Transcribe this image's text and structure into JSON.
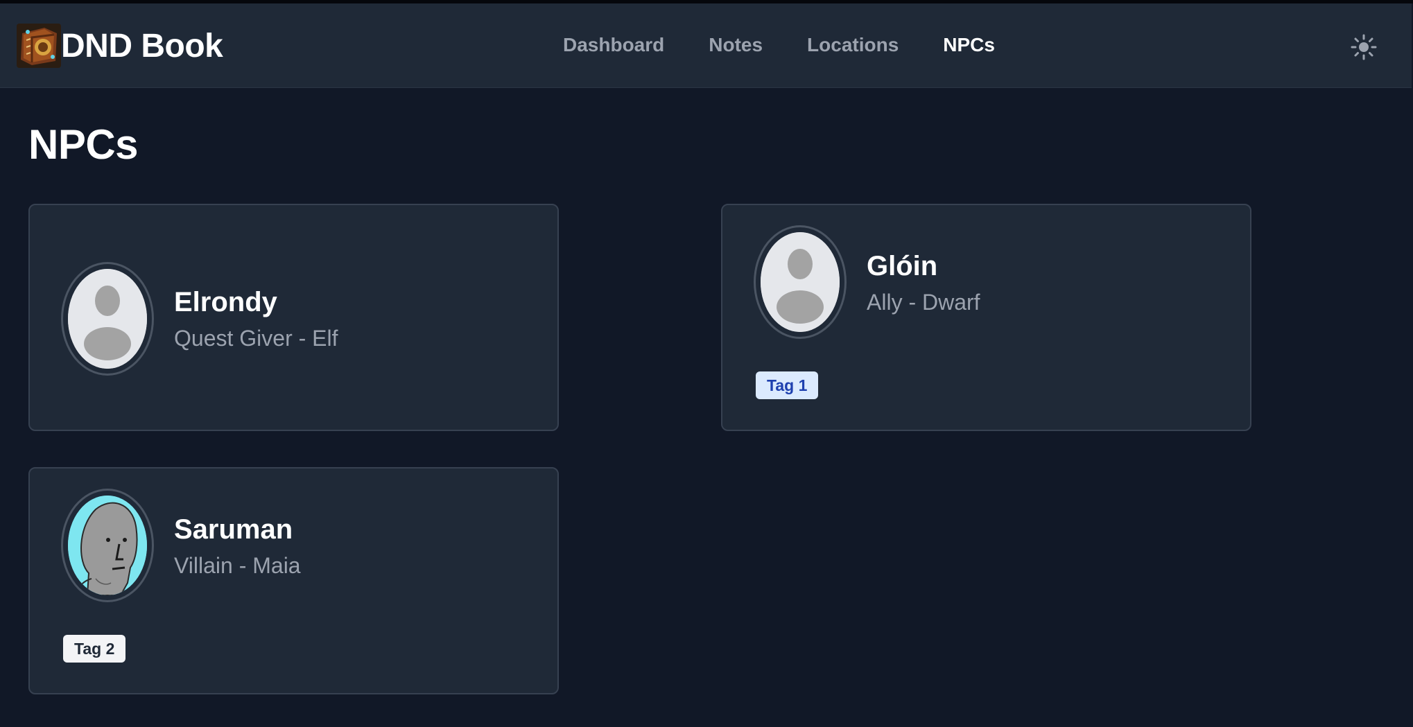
{
  "app": {
    "title": "DND Book",
    "logo_icon": "spellbook-logo-icon"
  },
  "nav": {
    "items": [
      {
        "label": "Dashboard",
        "active": false
      },
      {
        "label": "Notes",
        "active": false
      },
      {
        "label": "Locations",
        "active": false
      },
      {
        "label": "NPCs",
        "active": true
      }
    ],
    "theme_toggle_icon": "sun-icon"
  },
  "page": {
    "title": "NPCs"
  },
  "npcs": [
    {
      "name": "Elrondy",
      "subtitle": "Quest Giver - Elf",
      "avatar": "default-avatar-icon",
      "tags": []
    },
    {
      "name": "Glóin",
      "subtitle": "Ally - Dwarf",
      "avatar": "default-avatar-icon",
      "tags": [
        "Tag 1"
      ]
    },
    {
      "name": "Saruman",
      "subtitle": "Villain - Maia",
      "avatar": "npc-meme-face-avatar",
      "tags": [
        "Tag 2"
      ]
    }
  ],
  "colors": {
    "background": "#111827",
    "card": "#1f2937",
    "card_border": "#374151",
    "muted_text": "#9ca3af",
    "tag_blue_bg": "#dbeafe",
    "tag_blue_text": "#1e40af",
    "tag_gray_bg": "#f3f4f6"
  }
}
